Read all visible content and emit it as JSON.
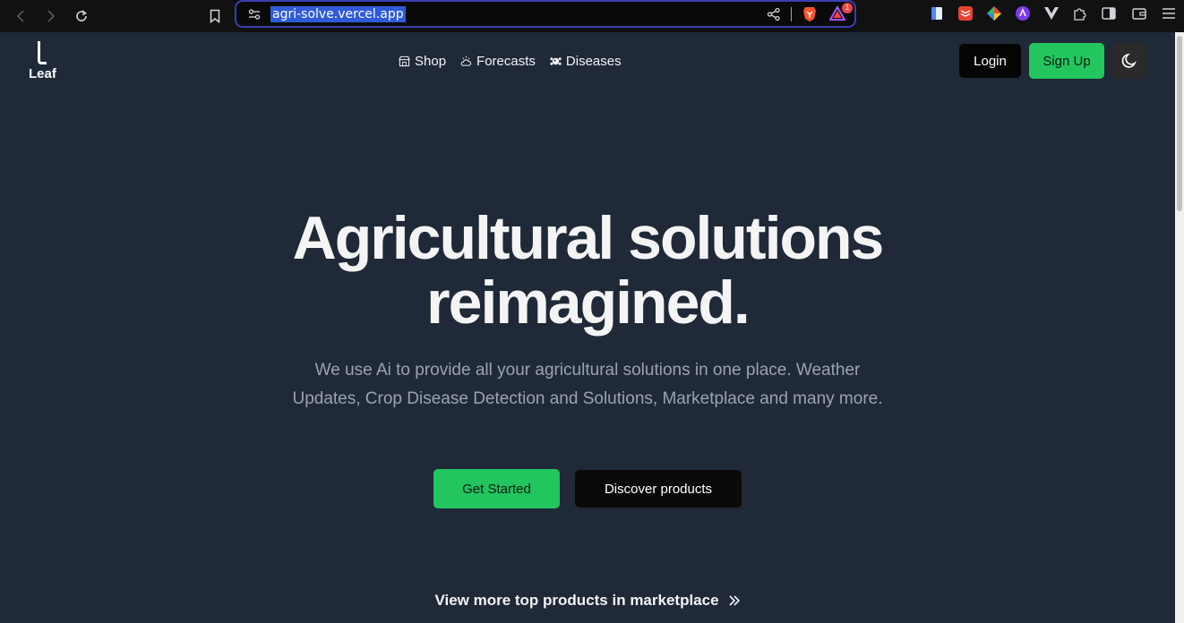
{
  "browser": {
    "url": "agri-solve.vercel.app",
    "rewards_badge": "1",
    "extensions": [
      "docs-icon",
      "todoist-icon",
      "colorzilla-icon",
      "ai-extension-icon",
      "vue-devtools-icon",
      "puzzle-icon",
      "sidebar-icon",
      "wallet-icon",
      "menu-icon"
    ]
  },
  "site": {
    "logo_text": "Leaf",
    "nav": [
      {
        "label": "Shop",
        "icon": "store-icon"
      },
      {
        "label": "Forecasts",
        "icon": "cloud-sun-icon"
      },
      {
        "label": "Diseases",
        "icon": "virus-icon"
      }
    ],
    "login_label": "Login",
    "signup_label": "Sign Up",
    "theme_icon": "moon-icon"
  },
  "hero": {
    "title_line1": "Agricultural solutions",
    "title_line2": "reimagined.",
    "subtitle": "We use Ai to provide all your agricultural solutions in one place. Weather Updates, Crop Disease Detection and Solutions, Marketplace and many more.",
    "primary_button": "Get Started",
    "secondary_button": "Discover products",
    "more_link": "View more top products in marketplace"
  },
  "colors": {
    "background": "#1f2937",
    "accent_green": "#22c55e",
    "dark_button": "#0c0a09"
  }
}
